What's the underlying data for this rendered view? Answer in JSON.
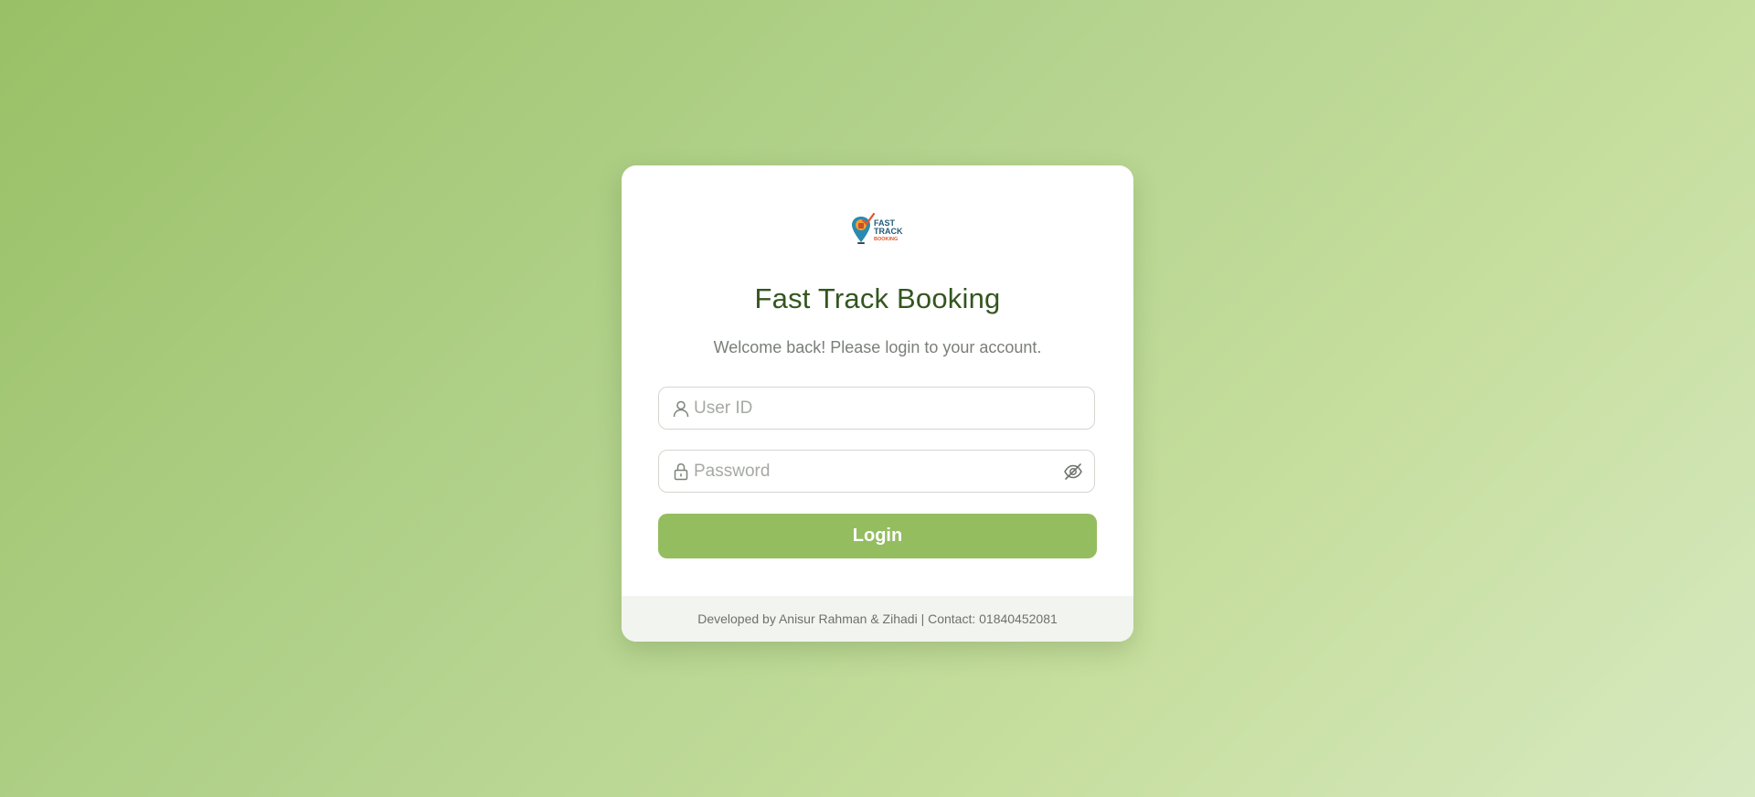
{
  "brand": {
    "logo_line1": "FAST",
    "logo_line2": "TRACK",
    "logo_line3": "BOOKING",
    "title": "Fast Track Booking",
    "subtitle": "Welcome back! Please login to your account."
  },
  "form": {
    "user_id_placeholder": "User ID",
    "user_id_value": "",
    "user_icon": "user-icon",
    "password_placeholder": "Password",
    "password_value": "",
    "lock_icon": "lock-icon",
    "toggle_icon": "eye-slash-icon",
    "login_label": "Login"
  },
  "footer": {
    "text": "Developed by Anisur Rahman & Zihadi | Contact: 01840452081"
  },
  "colors": {
    "accent": "#94bd60",
    "title": "#33561f",
    "background_start": "#99c066",
    "background_end": "#d7e9c1"
  }
}
